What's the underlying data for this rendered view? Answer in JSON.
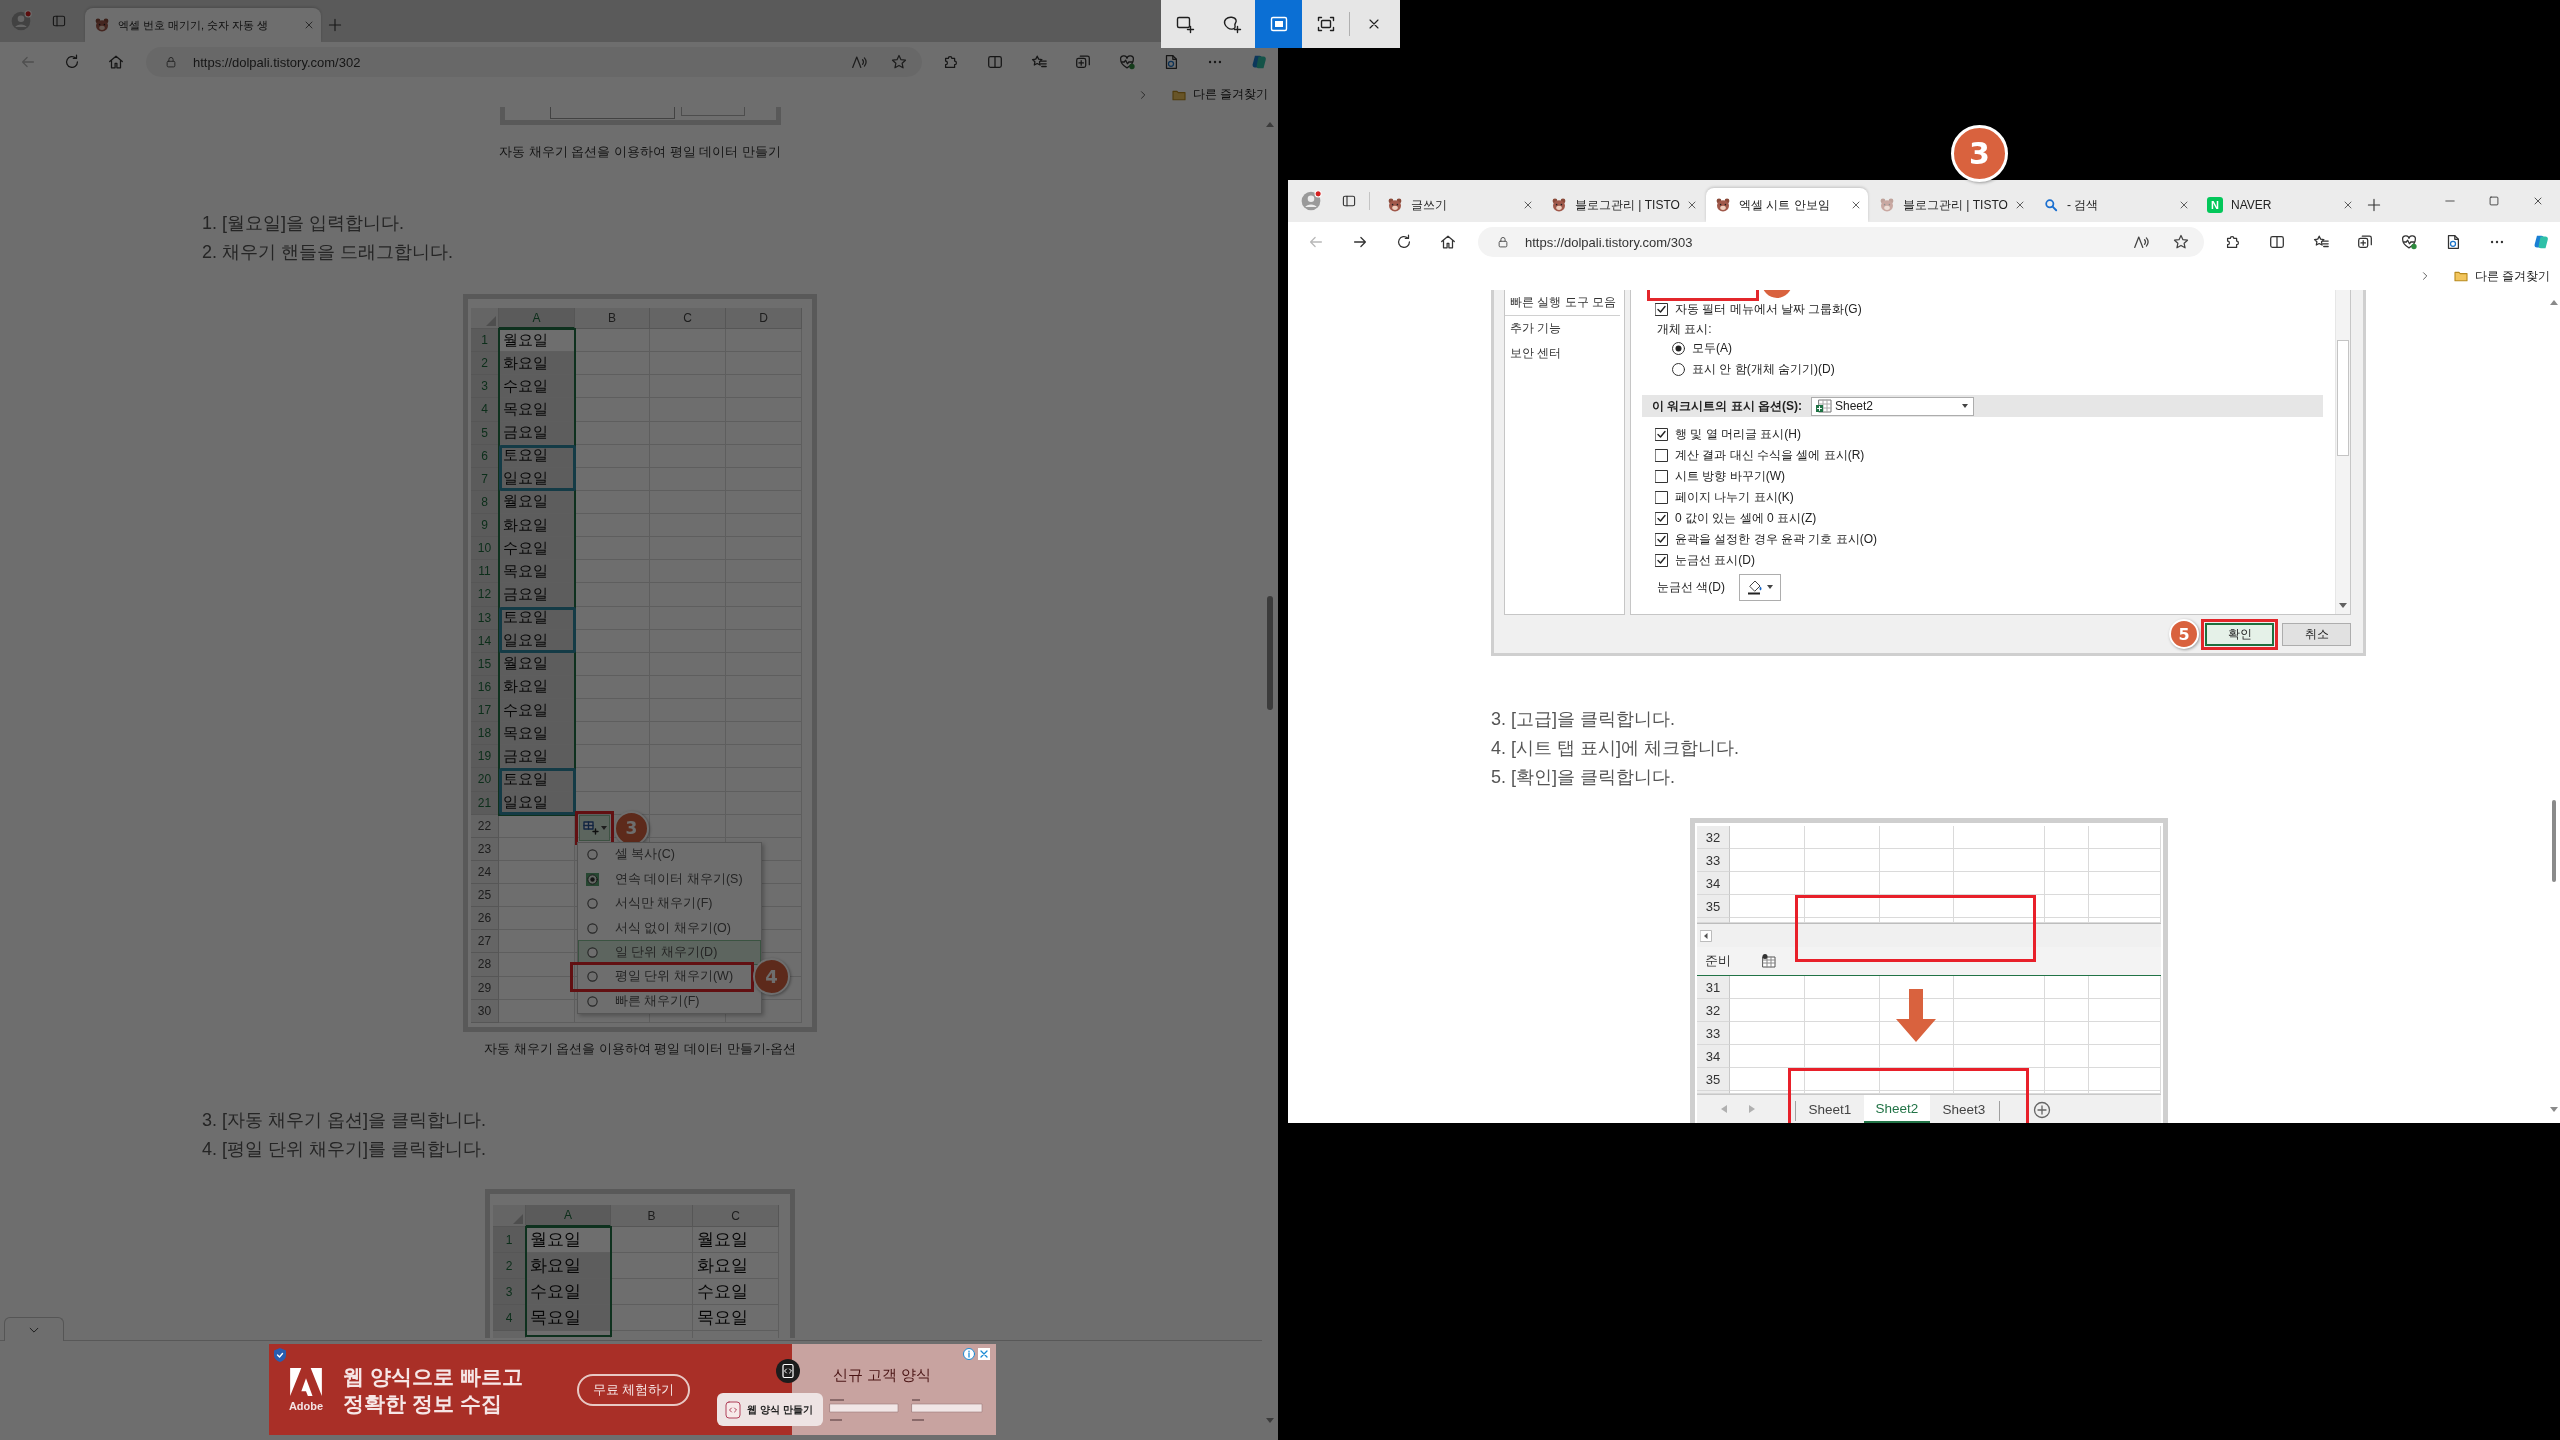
{
  "snip_toolbar": {
    "modes": [
      {
        "kind": "rectangle",
        "selected": false
      },
      {
        "kind": "freeform",
        "selected": false
      },
      {
        "kind": "window",
        "selected": true
      },
      {
        "kind": "fullscreen",
        "selected": false
      }
    ]
  },
  "left_browser": {
    "tabs": [
      {
        "title": "엑셀 번호 매기기, 숫자 자동 생",
        "kind": "blog",
        "selected": true,
        "sleeping": false
      }
    ],
    "back_disabled": true,
    "forward_shown": false,
    "url": "https://dolpali.tistory.com/302",
    "favorites_folder": "다른 즐겨찾기",
    "article": [
      {
        "kind": "image_fragment"
      },
      {
        "kind": "caption",
        "text": "자동 채우기 옵션을 이용하여 평일 데이터 만들기"
      },
      {
        "kind": "steps",
        "items": [
          "1. [월요일]을 입력합니다.",
          "2. 채우기 핸들을 드래그합니다."
        ]
      },
      {
        "kind": "fill_sheet",
        "columns": [
          "A",
          "B",
          "C",
          "D"
        ],
        "rows": [
          {
            "number": "1",
            "value": "월요일",
            "selected": true,
            "active": true,
            "weekend": false
          },
          {
            "number": "2",
            "value": "화요일",
            "selected": true,
            "active": false,
            "weekend": false
          },
          {
            "number": "3",
            "value": "수요일",
            "selected": true,
            "active": false,
            "weekend": false
          },
          {
            "number": "4",
            "value": "목요일",
            "selected": true,
            "active": false,
            "weekend": false
          },
          {
            "number": "5",
            "value": "금요일",
            "selected": true,
            "active": false,
            "weekend": false
          },
          {
            "number": "6",
            "value": "토요일",
            "selected": true,
            "active": false,
            "weekend": true
          },
          {
            "number": "7",
            "value": "일요일",
            "selected": true,
            "active": false,
            "weekend": true
          },
          {
            "number": "8",
            "value": "월요일",
            "selected": true,
            "active": false,
            "weekend": false
          },
          {
            "number": "9",
            "value": "화요일",
            "selected": true,
            "active": false,
            "weekend": false
          },
          {
            "number": "10",
            "value": "수요일",
            "selected": true,
            "active": false,
            "weekend": false
          },
          {
            "number": "11",
            "value": "목요일",
            "selected": true,
            "active": false,
            "weekend": false
          },
          {
            "number": "12",
            "value": "금요일",
            "selected": true,
            "active": false,
            "weekend": false
          },
          {
            "number": "13",
            "value": "토요일",
            "selected": true,
            "active": false,
            "weekend": true
          },
          {
            "number": "14",
            "value": "일요일",
            "selected": true,
            "active": false,
            "weekend": true
          },
          {
            "number": "15",
            "value": "월요일",
            "selected": true,
            "active": false,
            "weekend": false
          },
          {
            "number": "16",
            "value": "화요일",
            "selected": true,
            "active": false,
            "weekend": false
          },
          {
            "number": "17",
            "value": "수요일",
            "selected": true,
            "active": false,
            "weekend": false
          },
          {
            "number": "18",
            "value": "목요일",
            "selected": true,
            "active": false,
            "weekend": false
          },
          {
            "number": "19",
            "value": "금요일",
            "selected": true,
            "active": false,
            "weekend": false
          },
          {
            "number": "20",
            "value": "토요일",
            "selected": true,
            "active": false,
            "weekend": true
          },
          {
            "number": "21",
            "value": "일요일",
            "selected": true,
            "active": false,
            "weekend": true
          },
          {
            "number": "22",
            "selected": false,
            "active": false,
            "weekend": false
          },
          {
            "number": "23",
            "selected": false,
            "active": false,
            "weekend": false
          },
          {
            "number": "24",
            "selected": false,
            "active": false,
            "weekend": false
          },
          {
            "number": "25",
            "selected": false,
            "active": false,
            "weekend": false
          },
          {
            "number": "26",
            "selected": false,
            "active": false,
            "weekend": false
          },
          {
            "number": "27",
            "selected": false,
            "active": false,
            "weekend": false
          },
          {
            "number": "28",
            "selected": false,
            "active": false,
            "weekend": false
          },
          {
            "number": "29",
            "selected": false,
            "active": false,
            "weekend": false
          },
          {
            "number": "30",
            "selected": false,
            "active": false,
            "weekend": false
          }
        ],
        "options_badge": "3",
        "menu": [
          {
            "label": "셀 복사(C)",
            "selected": false,
            "hover": false,
            "marked": false
          },
          {
            "label": "연속 데이터 채우기(S)",
            "selected": true,
            "hover": false,
            "marked": false
          },
          {
            "label": "서식만 채우기(F)",
            "selected": false,
            "hover": false,
            "marked": false
          },
          {
            "label": "서식 없이 채우기(O)",
            "selected": false,
            "hover": false,
            "marked": false
          },
          {
            "label": "일 단위 채우기(D)",
            "selected": false,
            "hover": true,
            "marked": false
          },
          {
            "label": "평일 단위 채우기(W)",
            "selected": false,
            "hover": false,
            "marked": true
          },
          {
            "label": "빠른 채우기(F)",
            "selected": false,
            "hover": false,
            "marked": false
          }
        ],
        "menu_badge": "4"
      },
      {
        "kind": "caption",
        "text": "자동 채우기 옵션을 이용하여 평일 데이터 만들기-옵션"
      },
      {
        "kind": "steps",
        "items": [
          "3. [자동 채우기 옵션]을 클릭합니다.",
          "4. [평일 단위 채우기]를 클릭합니다."
        ]
      },
      {
        "kind": "result_sheet",
        "columns": [
          "A",
          "B",
          "C"
        ],
        "rows": [
          {
            "number": "1",
            "a": "월요일",
            "c": "월요일",
            "selected": true,
            "active": true
          },
          {
            "number": "2",
            "a": "화요일",
            "c": "화요일",
            "selected": true,
            "active": false
          },
          {
            "number": "3",
            "a": "수요일",
            "c": "수요일",
            "selected": true,
            "active": false
          },
          {
            "number": "4",
            "a": "목요일",
            "c": "목요일",
            "selected": true,
            "active": false
          }
        ]
      }
    ],
    "ad": {
      "brand": "Adobe",
      "headline": "웹 양식으로 빠르고\n정확한 정보 수집",
      "button": "무료 체험하기",
      "side_title": "신규 고객 양식",
      "popup": "웹 양식 만들기"
    }
  },
  "right_browser": {
    "badge": "3",
    "tabs": [
      {
        "title": "글쓰기",
        "kind": "blog",
        "selected": false,
        "sleeping": false
      },
      {
        "title": "블로그관리 | TISTO",
        "kind": "blog",
        "selected": false,
        "sleeping": false
      },
      {
        "title": "엑셀 시트 안보임",
        "kind": "blog",
        "selected": true,
        "sleeping": false
      },
      {
        "title": "블로그관리 | TISTO",
        "kind": "blog",
        "selected": false,
        "sleeping": true
      },
      {
        "title": "- 검색",
        "kind": "search",
        "selected": false,
        "sleeping": false
      },
      {
        "title": "NAVER",
        "kind": "letter",
        "favicon_letter": "N",
        "selected": false,
        "sleeping": false
      }
    ],
    "back_disabled": true,
    "forward_shown": true,
    "url": "https://dolpali.tistory.com/303",
    "favorites_folder": "다른 즐겨찾기",
    "options_dialog": {
      "nav": [
        "빠른 실행 도구 모음",
        "추가 기능",
        "보안 센터"
      ],
      "options": [
        {
          "kind": "checkbox",
          "label": "자동 필터 메뉴에서 날짜 그룹화(G)",
          "checked": true
        },
        {
          "kind": "heading",
          "label": "개체 표시:"
        },
        {
          "kind": "radio",
          "label": "모두(A)",
          "checked": true
        },
        {
          "kind": "radio",
          "label": "표시 안 함(개체 숨기기)(D)",
          "checked": false
        },
        {
          "kind": "section",
          "label": "이 워크시트의 표시 옵션(S):",
          "value": "Sheet2"
        },
        {
          "kind": "checkbox",
          "label": "행 및 열 머리글 표시(H)",
          "checked": true
        },
        {
          "kind": "checkbox",
          "label": "계산 결과 대신 수식을 셀에 표시(R)",
          "checked": false
        },
        {
          "kind": "checkbox",
          "label": "시트 방향 바꾸기(W)",
          "checked": false
        },
        {
          "kind": "checkbox",
          "label": "페이지 나누기 표시(K)",
          "checked": false
        },
        {
          "kind": "checkbox",
          "label": "0 값이 있는 셀에 0 표시(Z)",
          "checked": true
        },
        {
          "kind": "checkbox",
          "label": "윤곽을 설정한 경우 윤곽 기호 표시(O)",
          "checked": true
        },
        {
          "kind": "checkbox",
          "label": "눈금선 표시(D)",
          "checked": true
        },
        {
          "kind": "color",
          "label": "눈금선 색(D)"
        }
      ],
      "buttons": [
        {
          "label": "확인",
          "default": true,
          "marked": true,
          "badge": "5"
        },
        {
          "label": "취소",
          "default": false,
          "marked": false
        }
      ]
    },
    "steps": [
      "3. [고급]을 클릭합니다.",
      "4. [시트 탭 표시]에 체크합니다.",
      "5. [확인]을 클릭합니다."
    ],
    "sheet_tabs_image": {
      "before_rows": [
        "32",
        "33",
        "34",
        "35"
      ],
      "status": "준비",
      "after_rows": [
        "31",
        "32",
        "33",
        "34",
        "35"
      ],
      "sheets": [
        {
          "name": "Sheet1",
          "selected": false
        },
        {
          "name": "Sheet2",
          "selected": true
        },
        {
          "name": "Sheet3",
          "selected": false
        }
      ]
    }
  }
}
